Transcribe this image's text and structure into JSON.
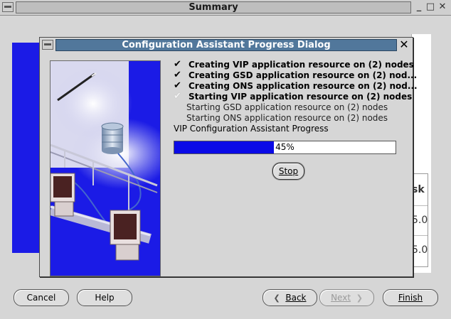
{
  "outer_window": {
    "title": "Summary",
    "controls": {
      "minimize": "_",
      "maximize": "□",
      "close": "✕"
    },
    "background_table_cells": [
      "sk",
      "5.0",
      "5.0"
    ]
  },
  "nav": {
    "cancel": "Cancel",
    "help": "Help",
    "back": "Back",
    "next": "Next",
    "finish": "Finish"
  },
  "dialog": {
    "title": "Configuration Assistant Progress Dialog",
    "close": "✕",
    "tasks": [
      {
        "label": "Creating VIP application resource on (2) nodes",
        "state": "done",
        "check": "✔"
      },
      {
        "label": "Creating GSD application resource on (2) nod...",
        "state": "done",
        "check": "✔"
      },
      {
        "label": "Creating ONS application resource on (2) nod...",
        "state": "done",
        "check": "✔"
      },
      {
        "label": "Starting VIP application resource on (2) nodes",
        "state": "current",
        "check": "✔"
      },
      {
        "label": "Starting GSD application resource on (2) nodes",
        "state": "pending",
        "check": ""
      },
      {
        "label": "Starting ONS application resource on (2) nodes",
        "state": "pending",
        "check": ""
      }
    ],
    "progress_label": "VIP Configuration Assistant Progress",
    "progress_percent": 45,
    "progress_text": "45%",
    "stop_label": "Stop"
  },
  "colors": {
    "dialog_title_bg": "#51779b",
    "progress_fill": "#0a0ae6",
    "graphic_blue": "#1b1be6"
  },
  "icons": {
    "back": "chevron-left-icon",
    "next": "chevron-right-icon",
    "check": "checkmark-icon"
  }
}
